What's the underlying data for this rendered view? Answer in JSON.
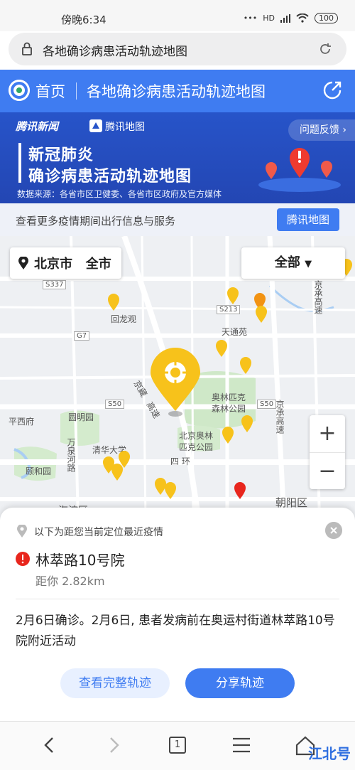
{
  "status_bar": {
    "time": "傍晚6:34",
    "network": "HD",
    "battery": "100"
  },
  "browser": {
    "url_title": "各地确诊病患活动轨迹地图",
    "tab_count": "1"
  },
  "header": {
    "home_label": "首页",
    "title": "各地确诊病患活动轨迹地图"
  },
  "banner": {
    "brand_news": "腾讯新闻",
    "brand_map": "腾讯地图",
    "feedback_label": "问题反馈 ›",
    "title_line1": "新冠肺炎",
    "title_line2": "确诊病患活动轨迹地图",
    "source": "数据来源：各省市区卫健委、各省市区政府及官方媒体"
  },
  "service": {
    "text": "查看更多疫情期间出行信息与服务",
    "button": "腾讯地图"
  },
  "map": {
    "city_selector": "北京市   全市",
    "filter": "全部",
    "zoom_in": "+",
    "zoom_out": "−",
    "labels": {
      "huilongguan": "回龙观",
      "tiantongyuan": "天通苑",
      "olympic_forest_1": "奥林匹克",
      "olympic_forest_2": "森林公园",
      "olympic_park_1": "北京奥林",
      "olympic_park_2": "匹克公园",
      "yuanmingyuan": "圆明园",
      "tsinghua": "清华大学",
      "yiheyuan": "颐和园",
      "pingxifu": "平西府",
      "fourth_ring": "四 环",
      "chaoyang": "朝阳区",
      "haidian": "海淀区",
      "jingzang_1": "京藏",
      "jingzang_2": "高速",
      "jingcheng_top": "京承高速",
      "jingcheng_mid": "京承高速",
      "wanquanhe": "万泉河路",
      "s337": "S337",
      "s213": "S213",
      "g7": "G7",
      "s50_left": "S50",
      "s50_right": "S50"
    }
  },
  "sheet": {
    "hint": "以下为距您当前定位最近疫情",
    "place": "林萃路10号院",
    "distance": "距你 2.82km",
    "description": "2月6日确诊。2月6日, 患者发病前在奥运村街道林萃路10号院附近活动",
    "btn_full": "查看完整轨迹",
    "btn_share": "分享轨迹"
  },
  "watermark": "江北号",
  "colors": {
    "brand_blue": "#3f7cf1",
    "banner_blue": "#2754c9",
    "pin_yellow": "#f7c21b",
    "pin_orange": "#f29313",
    "pin_red": "#e8261d"
  }
}
